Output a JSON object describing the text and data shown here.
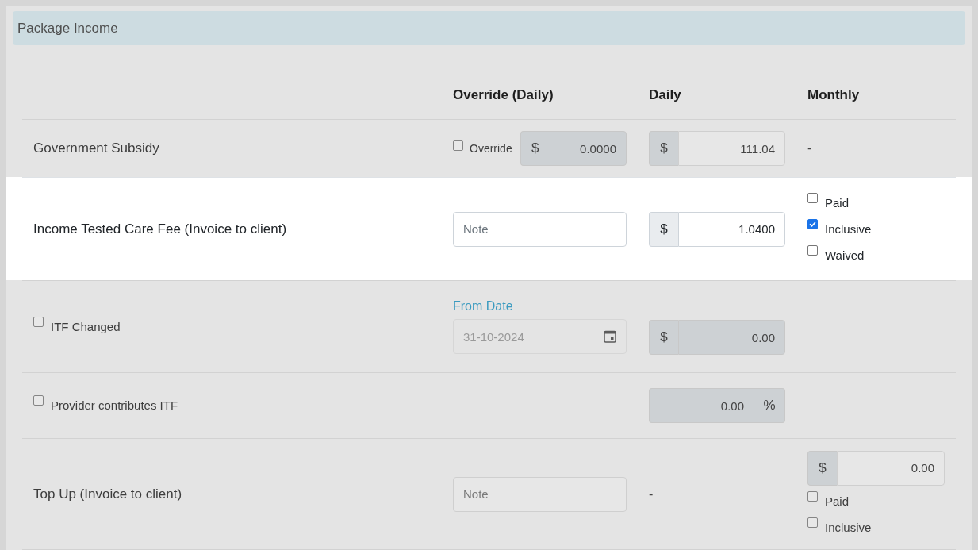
{
  "panel": {
    "title": "Package Income"
  },
  "table": {
    "columns": [
      "Override (Daily)",
      "Daily",
      "Monthly"
    ],
    "rows": [
      {
        "highlighted": false,
        "label": {
          "kind": "text",
          "text": "Government Subsidy"
        },
        "override": [
          {
            "kind": "amount",
            "toggle": {
              "label": "Override",
              "checked": false
            },
            "prefix": "$",
            "value": "0.0000",
            "disabled": true
          }
        ],
        "daily": [
          {
            "kind": "amount",
            "prefix": "$",
            "value": "111.04",
            "disabled": false
          }
        ],
        "monthly": [
          {
            "kind": "text",
            "text": "-"
          }
        ]
      },
      {
        "highlighted": true,
        "label": {
          "kind": "text",
          "text": "Income Tested Care Fee (Invoice to client)"
        },
        "override": [
          {
            "kind": "note",
            "placeholder": "Note"
          }
        ],
        "daily": [
          {
            "kind": "amount",
            "prefix": "$",
            "value": "1.0400",
            "disabled": false
          }
        ],
        "monthly": [
          {
            "kind": "checkbox",
            "label": "Paid",
            "checked": false
          },
          {
            "kind": "checkbox",
            "label": "Inclusive",
            "checked": true
          },
          {
            "kind": "checkbox",
            "label": "Waived",
            "checked": false
          }
        ]
      },
      {
        "highlighted": false,
        "label": {
          "kind": "checkbox",
          "label": "ITF Changed",
          "checked": false
        },
        "override": [
          {
            "kind": "date",
            "caption": "From Date",
            "value": "31-10-2024",
            "disabled": true
          }
        ],
        "daily": [
          {
            "kind": "amount",
            "prefix": "$",
            "value": "0.00",
            "disabled": true
          }
        ]
      },
      {
        "highlighted": false,
        "label": {
          "kind": "checkbox",
          "label": "Provider contributes ITF",
          "checked": false
        },
        "daily": [
          {
            "kind": "amount",
            "value": "0.00",
            "suffix": "%",
            "disabled": true
          }
        ]
      },
      {
        "highlighted": false,
        "label": {
          "kind": "text",
          "text": "Top Up (Invoice to client)"
        },
        "override": [
          {
            "kind": "note",
            "placeholder": "Note"
          }
        ],
        "daily": [
          {
            "kind": "text",
            "text": "-"
          }
        ],
        "monthly": [
          {
            "kind": "amount",
            "prefix": "$",
            "value": "0.00",
            "disabled": false
          },
          {
            "kind": "checkbox",
            "label": "Paid",
            "checked": false
          },
          {
            "kind": "checkbox",
            "label": "Inclusive",
            "checked": false
          }
        ]
      }
    ]
  }
}
